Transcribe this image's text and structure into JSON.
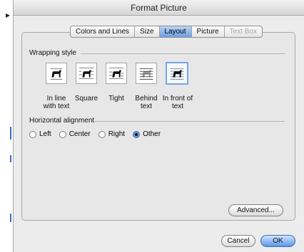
{
  "window": {
    "title": "Format Picture"
  },
  "tabs": [
    {
      "label": "Colors and Lines",
      "state": "normal"
    },
    {
      "label": "Size",
      "state": "normal"
    },
    {
      "label": "Layout",
      "state": "active"
    },
    {
      "label": "Picture",
      "state": "normal"
    },
    {
      "label": "Text Box",
      "state": "disabled"
    }
  ],
  "wrapping": {
    "label": "Wrapping style",
    "options": [
      {
        "caption_line1": "In line",
        "caption_line2": "with text",
        "icon": "inline-wrap-icon",
        "selected": false
      },
      {
        "caption_line1": "Square",
        "caption_line2": "",
        "icon": "square-wrap-icon",
        "selected": false
      },
      {
        "caption_line1": "Tight",
        "caption_line2": "",
        "icon": "tight-wrap-icon",
        "selected": false
      },
      {
        "caption_line1": "Behind",
        "caption_line2": "text",
        "icon": "behind-text-icon",
        "selected": false
      },
      {
        "caption_line1": "In front of",
        "caption_line2": "text",
        "icon": "in-front-of-text-icon",
        "selected": true
      }
    ]
  },
  "alignment": {
    "label": "Horizontal alignment",
    "options": [
      {
        "label": "Left",
        "checked": false
      },
      {
        "label": "Center",
        "checked": false
      },
      {
        "label": "Right",
        "checked": false
      },
      {
        "label": "Other",
        "checked": true
      }
    ]
  },
  "buttons": {
    "advanced": "Advanced...",
    "cancel": "Cancel",
    "ok": "OK"
  },
  "colors": {
    "accent": "#6e9ee0",
    "selected_border": "#7aa6e0",
    "window_bg": "#ececec"
  }
}
